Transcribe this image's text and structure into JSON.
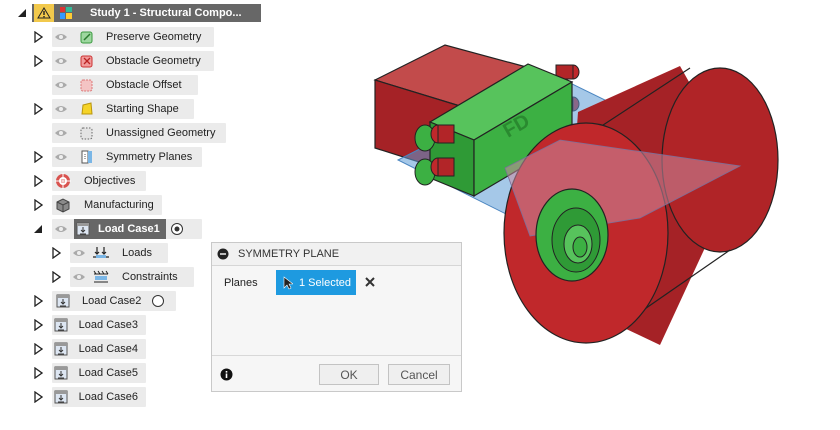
{
  "browser": {
    "header": {
      "title": "Study 1 - Structural Compo...",
      "warning_icon": "warning-icon"
    },
    "items": [
      {
        "label": "Preserve Geometry",
        "icon": "preserve-geometry-icon"
      },
      {
        "label": "Obstacle Geometry",
        "icon": "obstacle-geometry-icon"
      },
      {
        "label": "Obstacle Offset",
        "icon": "obstacle-offset-icon"
      },
      {
        "label": "Starting Shape",
        "icon": "starting-shape-icon"
      },
      {
        "label": "Unassigned Geometry",
        "icon": "unassigned-geometry-icon"
      },
      {
        "label": "Symmetry Planes",
        "icon": "symmetry-planes-icon"
      },
      {
        "label": "Objectives",
        "icon": "objectives-icon"
      },
      {
        "label": "Manufacturing",
        "icon": "manufacturing-icon"
      }
    ],
    "load_cases": [
      {
        "label": "Load Case1",
        "active": true
      },
      {
        "label": "Load Case2"
      },
      {
        "label": "Load Case3"
      },
      {
        "label": "Load Case4"
      },
      {
        "label": "Load Case5"
      },
      {
        "label": "Load Case6"
      }
    ],
    "load_case1_children": [
      {
        "label": "Loads",
        "icon": "loads-icon"
      },
      {
        "label": "Constraints",
        "icon": "constraints-icon"
      }
    ]
  },
  "dialog": {
    "title": "SYMMETRY PLANE",
    "planes_label": "Planes",
    "selection_text": "1 Selected",
    "ok_label": "OK",
    "cancel_label": "Cancel"
  },
  "colors": {
    "header_bg": "#676767",
    "selection_blue": "#1e9ae0",
    "model_red": "#c0282b",
    "model_green": "#3cb043",
    "plane_blue": "#5b9bd5"
  }
}
